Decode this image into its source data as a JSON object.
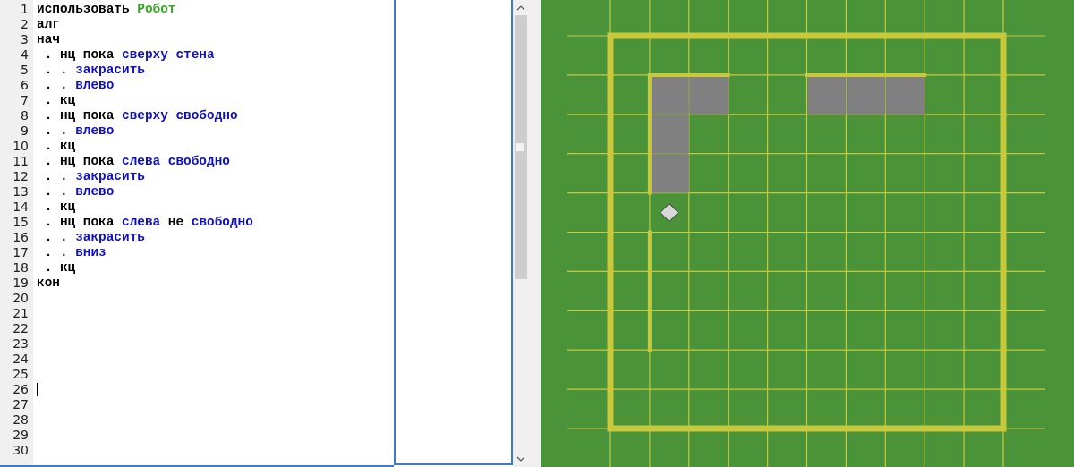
{
  "editor": {
    "lines": [
      {
        "number": "1",
        "cursor": false,
        "segments": [
          {
            "kind": "keyword",
            "text": "использовать "
          },
          {
            "kind": "module",
            "text": "Робот"
          }
        ]
      },
      {
        "number": "2",
        "cursor": false,
        "segments": [
          {
            "kind": "keyword",
            "text": "алг"
          }
        ]
      },
      {
        "number": "3",
        "cursor": false,
        "segments": [
          {
            "kind": "keyword",
            "text": "нач"
          }
        ]
      },
      {
        "number": "4",
        "cursor": false,
        "segments": [
          {
            "kind": "keyword",
            "text": " . нц пока "
          },
          {
            "kind": "command",
            "text": "сверху стена"
          }
        ]
      },
      {
        "number": "5",
        "cursor": false,
        "segments": [
          {
            "kind": "keyword",
            "text": " . . "
          },
          {
            "kind": "command",
            "text": "закрасить"
          }
        ]
      },
      {
        "number": "6",
        "cursor": false,
        "segments": [
          {
            "kind": "keyword",
            "text": " . . "
          },
          {
            "kind": "command",
            "text": "влево"
          }
        ]
      },
      {
        "number": "7",
        "cursor": false,
        "segments": [
          {
            "kind": "keyword",
            "text": " . кц"
          }
        ]
      },
      {
        "number": "8",
        "cursor": false,
        "segments": [
          {
            "kind": "keyword",
            "text": " . нц пока "
          },
          {
            "kind": "command",
            "text": "сверху свободно"
          }
        ]
      },
      {
        "number": "9",
        "cursor": false,
        "segments": [
          {
            "kind": "keyword",
            "text": " . . "
          },
          {
            "kind": "command",
            "text": "влево"
          }
        ]
      },
      {
        "number": "10",
        "cursor": false,
        "segments": [
          {
            "kind": "keyword",
            "text": " . кц"
          }
        ]
      },
      {
        "number": "11",
        "cursor": false,
        "segments": [
          {
            "kind": "keyword",
            "text": " . нц пока "
          },
          {
            "kind": "command",
            "text": "слева свободно"
          }
        ]
      },
      {
        "number": "12",
        "cursor": false,
        "segments": [
          {
            "kind": "keyword",
            "text": " . . "
          },
          {
            "kind": "command",
            "text": "закрасить"
          }
        ]
      },
      {
        "number": "13",
        "cursor": false,
        "segments": [
          {
            "kind": "keyword",
            "text": " . . "
          },
          {
            "kind": "command",
            "text": "влево"
          }
        ]
      },
      {
        "number": "14",
        "cursor": false,
        "segments": [
          {
            "kind": "keyword",
            "text": " . кц"
          }
        ]
      },
      {
        "number": "15",
        "cursor": false,
        "segments": [
          {
            "kind": "keyword",
            "text": " . нц пока "
          },
          {
            "kind": "command",
            "text": "слева "
          },
          {
            "kind": "keyword",
            "text": "не "
          },
          {
            "kind": "command",
            "text": "свободно"
          }
        ]
      },
      {
        "number": "16",
        "cursor": false,
        "segments": [
          {
            "kind": "keyword",
            "text": " . . "
          },
          {
            "kind": "command",
            "text": "закрасить"
          }
        ]
      },
      {
        "number": "17",
        "cursor": false,
        "segments": [
          {
            "kind": "keyword",
            "text": " . . "
          },
          {
            "kind": "command",
            "text": "вниз"
          }
        ]
      },
      {
        "number": "18",
        "cursor": false,
        "segments": [
          {
            "kind": "keyword",
            "text": " . кц"
          }
        ]
      },
      {
        "number": "19",
        "cursor": false,
        "segments": [
          {
            "kind": "keyword",
            "text": "кон"
          }
        ]
      },
      {
        "number": "20",
        "cursor": false
      },
      {
        "number": "21",
        "cursor": false
      },
      {
        "number": "22",
        "cursor": false
      },
      {
        "number": "23",
        "cursor": false
      },
      {
        "number": "24",
        "cursor": false
      },
      {
        "number": "25",
        "cursor": false
      },
      {
        "number": "26",
        "cursor": true
      },
      {
        "number": "27",
        "cursor": false
      },
      {
        "number": "28",
        "cursor": false
      },
      {
        "number": "29",
        "cursor": false
      },
      {
        "number": "30",
        "cursor": false
      }
    ]
  },
  "field": {
    "rows": [
      {
        "cells": [
          {
            "painted": false,
            "robot": false
          },
          {
            "painted": false,
            "robot": false
          },
          {
            "painted": false,
            "robot": false
          },
          {
            "painted": false,
            "robot": false
          },
          {
            "painted": false,
            "robot": false
          },
          {
            "painted": false,
            "robot": false
          },
          {
            "painted": false,
            "robot": false
          },
          {
            "painted": false,
            "robot": false
          },
          {
            "painted": false,
            "robot": false
          },
          {
            "painted": false,
            "robot": false
          }
        ]
      },
      {
        "cells": [
          {
            "painted": false,
            "robot": false
          },
          {
            "painted": true,
            "robot": false
          },
          {
            "painted": true,
            "robot": false
          },
          {
            "painted": false,
            "robot": false
          },
          {
            "painted": false,
            "robot": false
          },
          {
            "painted": true,
            "robot": false
          },
          {
            "painted": true,
            "robot": false
          },
          {
            "painted": true,
            "robot": false
          },
          {
            "painted": false,
            "robot": false
          },
          {
            "painted": false,
            "robot": false
          }
        ]
      },
      {
        "cells": [
          {
            "painted": false,
            "robot": false
          },
          {
            "painted": true,
            "robot": false
          },
          {
            "painted": false,
            "robot": false
          },
          {
            "painted": false,
            "robot": false
          },
          {
            "painted": false,
            "robot": false
          },
          {
            "painted": false,
            "robot": false
          },
          {
            "painted": false,
            "robot": false
          },
          {
            "painted": false,
            "robot": false
          },
          {
            "painted": false,
            "robot": false
          },
          {
            "painted": false,
            "robot": false
          }
        ]
      },
      {
        "cells": [
          {
            "painted": false,
            "robot": false
          },
          {
            "painted": true,
            "robot": false
          },
          {
            "painted": false,
            "robot": false
          },
          {
            "painted": false,
            "robot": false
          },
          {
            "painted": false,
            "robot": false
          },
          {
            "painted": false,
            "robot": false
          },
          {
            "painted": false,
            "robot": false
          },
          {
            "painted": false,
            "robot": false
          },
          {
            "painted": false,
            "robot": false
          },
          {
            "painted": false,
            "robot": false
          }
        ]
      },
      {
        "cells": [
          {
            "painted": false,
            "robot": false
          },
          {
            "painted": false,
            "robot": true
          },
          {
            "painted": false,
            "robot": false
          },
          {
            "painted": false,
            "robot": false
          },
          {
            "painted": false,
            "robot": false
          },
          {
            "painted": false,
            "robot": false
          },
          {
            "painted": false,
            "robot": false
          },
          {
            "painted": false,
            "robot": false
          },
          {
            "painted": false,
            "robot": false
          },
          {
            "painted": false,
            "robot": false
          }
        ]
      },
      {
        "cells": [
          {
            "painted": false,
            "robot": false
          },
          {
            "painted": false,
            "robot": false
          },
          {
            "painted": false,
            "robot": false
          },
          {
            "painted": false,
            "robot": false
          },
          {
            "painted": false,
            "robot": false
          },
          {
            "painted": false,
            "robot": false
          },
          {
            "painted": false,
            "robot": false
          },
          {
            "painted": false,
            "robot": false
          },
          {
            "painted": false,
            "robot": false
          },
          {
            "painted": false,
            "robot": false
          }
        ]
      },
      {
        "cells": [
          {
            "painted": false,
            "robot": false
          },
          {
            "painted": false,
            "robot": false
          },
          {
            "painted": false,
            "robot": false
          },
          {
            "painted": false,
            "robot": false
          },
          {
            "painted": false,
            "robot": false
          },
          {
            "painted": false,
            "robot": false
          },
          {
            "painted": false,
            "robot": false
          },
          {
            "painted": false,
            "robot": false
          },
          {
            "painted": false,
            "robot": false
          },
          {
            "painted": false,
            "robot": false
          }
        ]
      },
      {
        "cells": [
          {
            "painted": false,
            "robot": false
          },
          {
            "painted": false,
            "robot": false
          },
          {
            "painted": false,
            "robot": false
          },
          {
            "painted": false,
            "robot": false
          },
          {
            "painted": false,
            "robot": false
          },
          {
            "painted": false,
            "robot": false
          },
          {
            "painted": false,
            "robot": false
          },
          {
            "painted": false,
            "robot": false
          },
          {
            "painted": false,
            "robot": false
          },
          {
            "painted": false,
            "robot": false
          }
        ]
      },
      {
        "cells": [
          {
            "painted": false,
            "robot": false
          },
          {
            "painted": false,
            "robot": false
          },
          {
            "painted": false,
            "robot": false
          },
          {
            "painted": false,
            "robot": false
          },
          {
            "painted": false,
            "robot": false
          },
          {
            "painted": false,
            "robot": false
          },
          {
            "painted": false,
            "robot": false
          },
          {
            "painted": false,
            "robot": false
          },
          {
            "painted": false,
            "robot": false
          },
          {
            "painted": false,
            "robot": false
          }
        ]
      },
      {
        "cells": [
          {
            "painted": false,
            "robot": false
          },
          {
            "painted": false,
            "robot": false
          },
          {
            "painted": false,
            "robot": false
          },
          {
            "painted": false,
            "robot": false
          },
          {
            "painted": false,
            "robot": false
          },
          {
            "painted": false,
            "robot": false
          },
          {
            "painted": false,
            "robot": false
          },
          {
            "painted": false,
            "robot": false
          },
          {
            "painted": false,
            "robot": false
          },
          {
            "painted": false,
            "robot": false
          }
        ]
      }
    ]
  }
}
